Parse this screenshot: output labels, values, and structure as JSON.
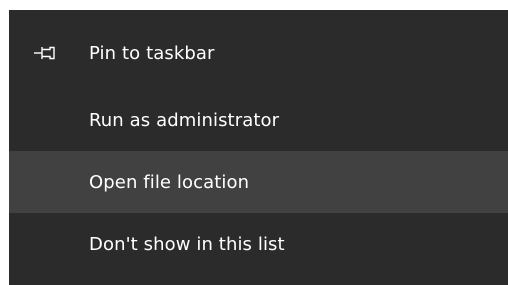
{
  "context_menu": {
    "items": [
      {
        "label": "Pin to taskbar",
        "icon": "pin-icon",
        "highlighted": false
      },
      {
        "label": "Run as administrator",
        "icon": "",
        "highlighted": false
      },
      {
        "label": "Open file location",
        "icon": "",
        "highlighted": true
      },
      {
        "label": "Don't show in this list",
        "icon": "",
        "highlighted": false
      }
    ],
    "colors": {
      "background": "#2b2b2b",
      "highlight": "#414141",
      "text": "#ffffff"
    }
  }
}
